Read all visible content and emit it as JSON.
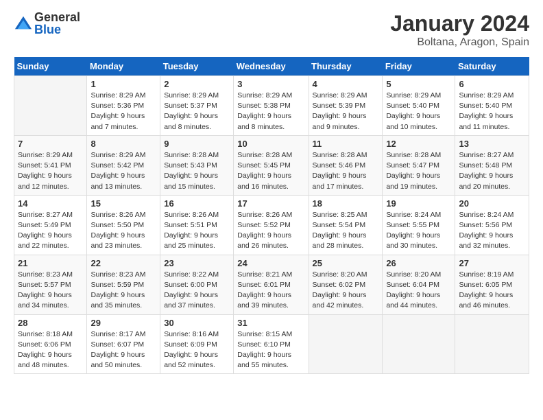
{
  "logo": {
    "general": "General",
    "blue": "Blue"
  },
  "title": "January 2024",
  "location": "Boltana, Aragon, Spain",
  "weekdays": [
    "Sunday",
    "Monday",
    "Tuesday",
    "Wednesday",
    "Thursday",
    "Friday",
    "Saturday"
  ],
  "weeks": [
    [
      {
        "day": "",
        "info": ""
      },
      {
        "day": "1",
        "info": "Sunrise: 8:29 AM\nSunset: 5:36 PM\nDaylight: 9 hours\nand 7 minutes."
      },
      {
        "day": "2",
        "info": "Sunrise: 8:29 AM\nSunset: 5:37 PM\nDaylight: 9 hours\nand 8 minutes."
      },
      {
        "day": "3",
        "info": "Sunrise: 8:29 AM\nSunset: 5:38 PM\nDaylight: 9 hours\nand 8 minutes."
      },
      {
        "day": "4",
        "info": "Sunrise: 8:29 AM\nSunset: 5:39 PM\nDaylight: 9 hours\nand 9 minutes."
      },
      {
        "day": "5",
        "info": "Sunrise: 8:29 AM\nSunset: 5:40 PM\nDaylight: 9 hours\nand 10 minutes."
      },
      {
        "day": "6",
        "info": "Sunrise: 8:29 AM\nSunset: 5:40 PM\nDaylight: 9 hours\nand 11 minutes."
      }
    ],
    [
      {
        "day": "7",
        "info": "Sunrise: 8:29 AM\nSunset: 5:41 PM\nDaylight: 9 hours\nand 12 minutes."
      },
      {
        "day": "8",
        "info": "Sunrise: 8:29 AM\nSunset: 5:42 PM\nDaylight: 9 hours\nand 13 minutes."
      },
      {
        "day": "9",
        "info": "Sunrise: 8:28 AM\nSunset: 5:43 PM\nDaylight: 9 hours\nand 15 minutes."
      },
      {
        "day": "10",
        "info": "Sunrise: 8:28 AM\nSunset: 5:45 PM\nDaylight: 9 hours\nand 16 minutes."
      },
      {
        "day": "11",
        "info": "Sunrise: 8:28 AM\nSunset: 5:46 PM\nDaylight: 9 hours\nand 17 minutes."
      },
      {
        "day": "12",
        "info": "Sunrise: 8:28 AM\nSunset: 5:47 PM\nDaylight: 9 hours\nand 19 minutes."
      },
      {
        "day": "13",
        "info": "Sunrise: 8:27 AM\nSunset: 5:48 PM\nDaylight: 9 hours\nand 20 minutes."
      }
    ],
    [
      {
        "day": "14",
        "info": "Sunrise: 8:27 AM\nSunset: 5:49 PM\nDaylight: 9 hours\nand 22 minutes."
      },
      {
        "day": "15",
        "info": "Sunrise: 8:26 AM\nSunset: 5:50 PM\nDaylight: 9 hours\nand 23 minutes."
      },
      {
        "day": "16",
        "info": "Sunrise: 8:26 AM\nSunset: 5:51 PM\nDaylight: 9 hours\nand 25 minutes."
      },
      {
        "day": "17",
        "info": "Sunrise: 8:26 AM\nSunset: 5:52 PM\nDaylight: 9 hours\nand 26 minutes."
      },
      {
        "day": "18",
        "info": "Sunrise: 8:25 AM\nSunset: 5:54 PM\nDaylight: 9 hours\nand 28 minutes."
      },
      {
        "day": "19",
        "info": "Sunrise: 8:24 AM\nSunset: 5:55 PM\nDaylight: 9 hours\nand 30 minutes."
      },
      {
        "day": "20",
        "info": "Sunrise: 8:24 AM\nSunset: 5:56 PM\nDaylight: 9 hours\nand 32 minutes."
      }
    ],
    [
      {
        "day": "21",
        "info": "Sunrise: 8:23 AM\nSunset: 5:57 PM\nDaylight: 9 hours\nand 34 minutes."
      },
      {
        "day": "22",
        "info": "Sunrise: 8:23 AM\nSunset: 5:59 PM\nDaylight: 9 hours\nand 35 minutes."
      },
      {
        "day": "23",
        "info": "Sunrise: 8:22 AM\nSunset: 6:00 PM\nDaylight: 9 hours\nand 37 minutes."
      },
      {
        "day": "24",
        "info": "Sunrise: 8:21 AM\nSunset: 6:01 PM\nDaylight: 9 hours\nand 39 minutes."
      },
      {
        "day": "25",
        "info": "Sunrise: 8:20 AM\nSunset: 6:02 PM\nDaylight: 9 hours\nand 42 minutes."
      },
      {
        "day": "26",
        "info": "Sunrise: 8:20 AM\nSunset: 6:04 PM\nDaylight: 9 hours\nand 44 minutes."
      },
      {
        "day": "27",
        "info": "Sunrise: 8:19 AM\nSunset: 6:05 PM\nDaylight: 9 hours\nand 46 minutes."
      }
    ],
    [
      {
        "day": "28",
        "info": "Sunrise: 8:18 AM\nSunset: 6:06 PM\nDaylight: 9 hours\nand 48 minutes."
      },
      {
        "day": "29",
        "info": "Sunrise: 8:17 AM\nSunset: 6:07 PM\nDaylight: 9 hours\nand 50 minutes."
      },
      {
        "day": "30",
        "info": "Sunrise: 8:16 AM\nSunset: 6:09 PM\nDaylight: 9 hours\nand 52 minutes."
      },
      {
        "day": "31",
        "info": "Sunrise: 8:15 AM\nSunset: 6:10 PM\nDaylight: 9 hours\nand 55 minutes."
      },
      {
        "day": "",
        "info": ""
      },
      {
        "day": "",
        "info": ""
      },
      {
        "day": "",
        "info": ""
      }
    ]
  ]
}
